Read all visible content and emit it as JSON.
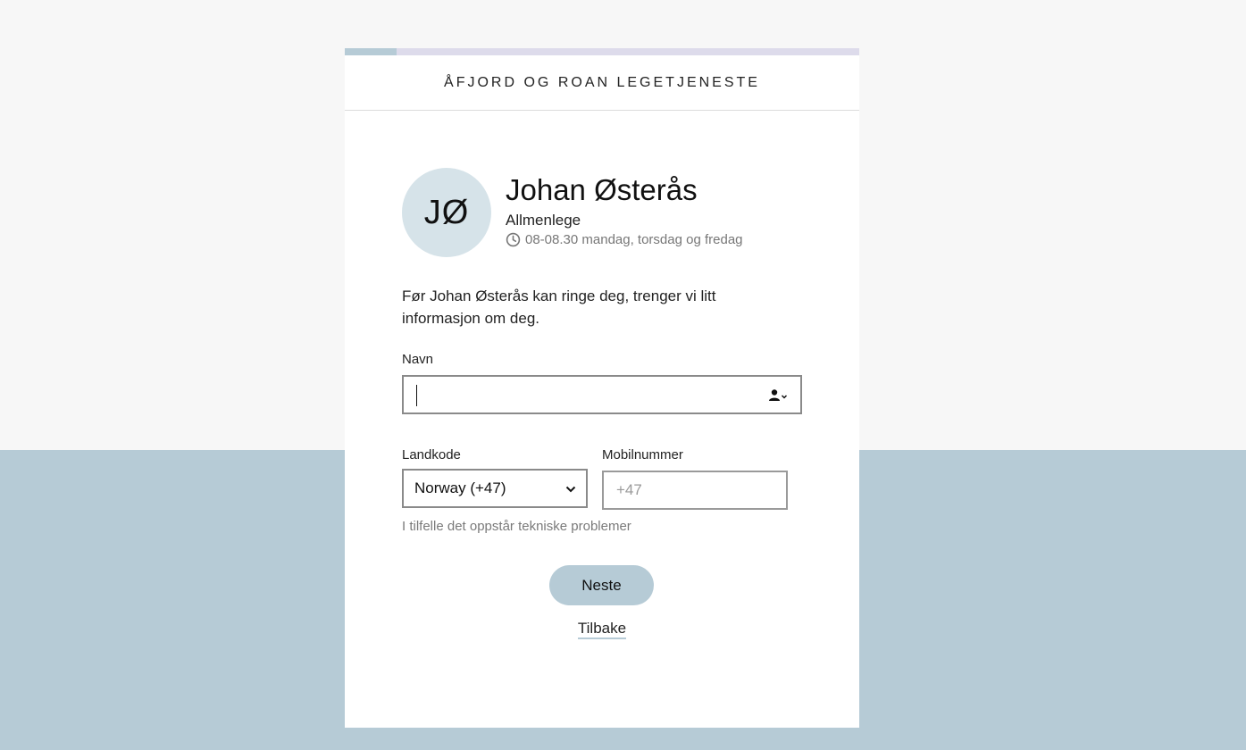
{
  "clinic": {
    "name": "ÅFJORD OG ROAN LEGETJENESTE"
  },
  "progress": {
    "fraction": 0.1
  },
  "doctor": {
    "initials": "JØ",
    "name": "Johan Østerås",
    "role": "Allmenlege",
    "hours": "08-08.30 mandag, torsdag og fredag",
    "hours_icon": "clock-icon"
  },
  "intro": "Før Johan Østerås kan ringe deg, trenger vi litt informasjon om deg.",
  "form": {
    "name_label": "Navn",
    "name_value": "",
    "name_autofill_icon": "contact-autofill-icon",
    "country_label": "Landkode",
    "country_value": "Norway (+47)",
    "phone_label": "Mobilnummer",
    "phone_placeholder": "+47",
    "help": "I tilfelle det oppstår tekniske problemer"
  },
  "actions": {
    "next": "Neste",
    "back": "Tilbake"
  },
  "colors": {
    "accent": "#b6cbd6",
    "progress_track": "#dddbeb",
    "avatar_bg": "#d6e3e9"
  }
}
